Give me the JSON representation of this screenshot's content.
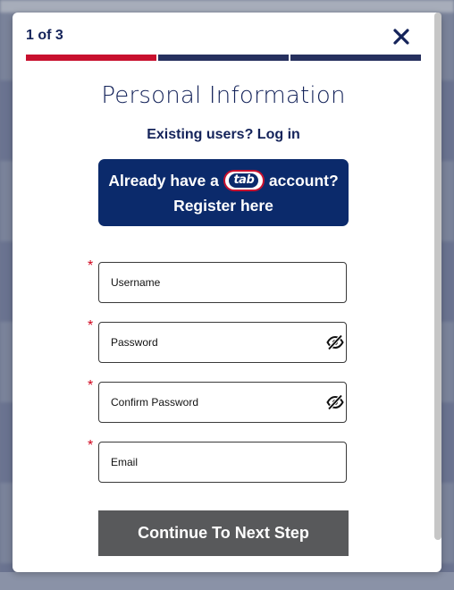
{
  "modal": {
    "step_label": "1 of 3",
    "progress": {
      "steps": 3,
      "current": 1,
      "active_color": "#c8102e",
      "inactive_color": "#26305e"
    },
    "title": "Personal Information",
    "login_link": "Existing users? Log in",
    "register_banner": {
      "prefix": "Already have a",
      "logo_text": "tab",
      "suffix": "account?",
      "line2": "Register here",
      "background": "#0b2a6b"
    },
    "fields": [
      {
        "placeholder": "Username",
        "required": true,
        "has_visibility_toggle": false
      },
      {
        "placeholder": "Password",
        "required": true,
        "has_visibility_toggle": true
      },
      {
        "placeholder": "Confirm Password",
        "required": true,
        "has_visibility_toggle": true
      },
      {
        "placeholder": "Email",
        "required": true,
        "has_visibility_toggle": false
      }
    ],
    "required_marker": "*",
    "continue_label": "Continue To Next Step"
  },
  "icons": {
    "close": "close-icon",
    "visibility": "eye-slash-icon"
  }
}
